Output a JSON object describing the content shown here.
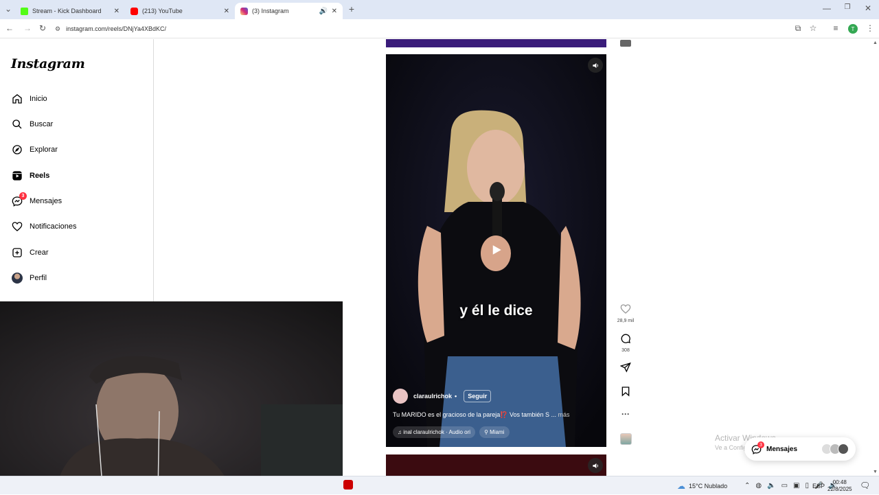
{
  "browser": {
    "tabs": [
      {
        "title": "Stream - Kick Dashboard",
        "favicon_color": "#53fc18"
      },
      {
        "title": "(213) YouTube",
        "favicon_color": "#ff0000"
      },
      {
        "title": "(3) Instagram",
        "favicon_color": "#d62976"
      }
    ],
    "new_tab_glyph": "+",
    "url": "instagram.com/reels/DNjYa4XBdKC/"
  },
  "sidebar": {
    "logo": "Instagram",
    "items": [
      {
        "label": "Inicio",
        "icon": "home-icon"
      },
      {
        "label": "Buscar",
        "icon": "search-icon"
      },
      {
        "label": "Explorar",
        "icon": "compass-icon"
      },
      {
        "label": "Reels",
        "icon": "reels-icon"
      },
      {
        "label": "Mensajes",
        "icon": "messenger-icon",
        "badge": "3"
      },
      {
        "label": "Notificaciones",
        "icon": "heart-icon"
      },
      {
        "label": "Crear",
        "icon": "plus-square-icon"
      },
      {
        "label": "Perfil",
        "icon": "avatar-icon"
      }
    ]
  },
  "reel": {
    "caption_overlay": "y él le dice",
    "author": "claraulrichok",
    "separator": "•",
    "follow_label": "Seguir",
    "description": "Tu MARIDO es el gracioso de la pareja⁉️ Vos también S ...",
    "more_label": "más",
    "audio": "inal  claraulrichok · Audio ori",
    "location": "Miami"
  },
  "actions": {
    "likes": "28,9 mil",
    "comments": "308"
  },
  "messages_bar": {
    "label": "Mensajes",
    "badge": "3"
  },
  "windows_watermark": {
    "line1": "Activar Windows",
    "line2": "Ve a Configuración para activar Windows."
  },
  "taskbar": {
    "weather": "15°C  Nublado",
    "language": "ESP",
    "time": "00:48",
    "date": "22/8/2025"
  },
  "colors": {
    "accent_badge": "#ff3040",
    "reel_bg": "#0e0d17"
  }
}
